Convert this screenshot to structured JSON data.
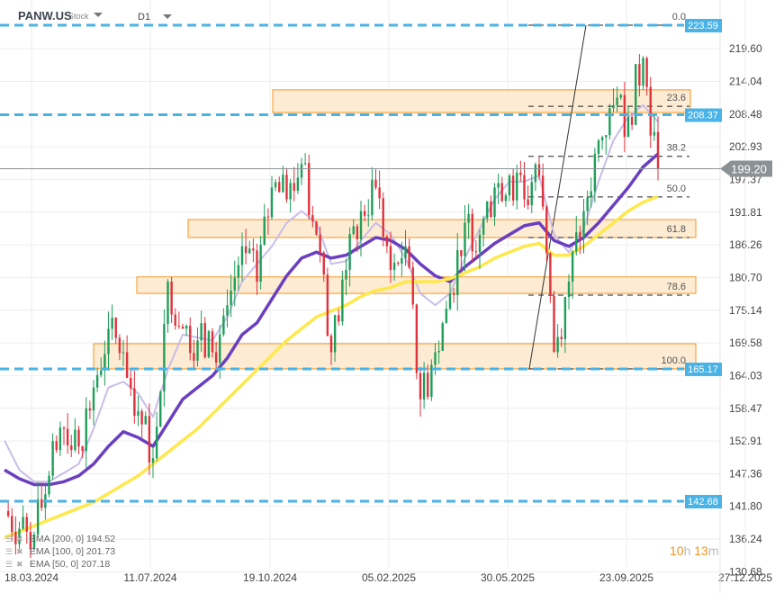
{
  "header": {
    "symbol": "PANW.US",
    "type": "Stock",
    "timeframe": "D1"
  },
  "legend": [
    {
      "label": "EMA [200,  0] 194.52",
      "color": "#ffe84d"
    },
    {
      "label": "EMA [100,  0] 201.73",
      "color": "#6a3fc0"
    },
    {
      "label": "EMA [50,  0] 207.18",
      "color": "#c9bde8"
    }
  ],
  "timer": {
    "hours": "10",
    "h": "h",
    "minutes": "13",
    "m": "m"
  },
  "chart_data": {
    "type": "candlestick",
    "ylim": [
      130.68,
      226.5
    ],
    "y_ticks": [
      "219.60",
      "214.04",
      "208.48",
      "202.93",
      "197.37",
      "191.81",
      "186.26",
      "180.70",
      "175.14",
      "169.58",
      "164.03",
      "158.47",
      "152.91",
      "147.36",
      "141.80",
      "136.24",
      "130.68"
    ],
    "x_ticks": [
      "18.03.2024",
      "11.07.2024",
      "19.10.2024",
      "05.02.2025",
      "30.05.2025",
      "23.09.2025",
      "27.12.2025"
    ],
    "dates": [
      "2024-02-09",
      "2024-02-23",
      "2024-03-08",
      "2024-03-22",
      "2024-04-05",
      "2024-04-19",
      "2024-05-03",
      "2024-05-17",
      "2024-05-31",
      "2024-06-14",
      "2024-06-28",
      "2024-07-12",
      "2024-07-26",
      "2024-08-09",
      "2024-08-23",
      "2024-09-06",
      "2024-09-20",
      "2024-10-04",
      "2024-10-18",
      "2024-11-01",
      "2024-11-15",
      "2024-11-29",
      "2024-12-13",
      "2024-12-27",
      "2025-01-10",
      "2025-01-24",
      "2025-02-07",
      "2025-02-21",
      "2025-03-07",
      "2025-03-21",
      "2025-04-04",
      "2025-04-18",
      "2025-05-02",
      "2025-05-16",
      "2025-05-30",
      "2025-06-13",
      "2025-06-27",
      "2025-07-11",
      "2025-07-25",
      "2025-08-08",
      "2025-08-22",
      "2025-09-05",
      "2025-09-19",
      "2025-10-03",
      "2025-10-17"
    ],
    "close": [
      141,
      138,
      137,
      147,
      155,
      152,
      162,
      172,
      168,
      158,
      150,
      180,
      172,
      170,
      168,
      176,
      186,
      180,
      196,
      194,
      200,
      188,
      168,
      182,
      192,
      196,
      182,
      186,
      160,
      168,
      178,
      190,
      188,
      196,
      198,
      194,
      198,
      168,
      180,
      192,
      204,
      210,
      208,
      218,
      199.2
    ],
    "series": [
      {
        "name": "EMA [200,  0]",
        "color": "#ffe84d",
        "values": [
          136.5,
          137.5,
          138.5,
          139.5,
          140.5,
          141.5,
          142.5,
          144,
          145.5,
          147,
          149,
          151,
          153,
          155,
          157.5,
          160,
          162.5,
          165,
          167.5,
          170,
          172,
          174,
          175,
          176,
          177.5,
          178.5,
          179,
          180,
          180,
          180,
          180.5,
          181.5,
          182.5,
          184,
          185,
          186,
          186.5,
          184.5,
          184.5,
          186,
          188,
          190,
          192,
          193.5,
          194.5
        ]
      },
      {
        "name": "EMA [100,  0]",
        "color": "#6a3fc0",
        "values": [
          148,
          146.5,
          145.5,
          145.5,
          146,
          147,
          149,
          152,
          154.5,
          153.5,
          152,
          156,
          160,
          162,
          164,
          167,
          171,
          173,
          177,
          181,
          184,
          185,
          184,
          184.5,
          186,
          187.5,
          187,
          185.5,
          183,
          181,
          180,
          182.5,
          184.5,
          186.5,
          188,
          189.5,
          190,
          187,
          186,
          187.5,
          190,
          193,
          196,
          199.5,
          201.7
        ]
      },
      {
        "name": "EMA [50,  0]",
        "color": "#c9bde8",
        "values": [
          153,
          148,
          146,
          146,
          147.5,
          149,
          155,
          162,
          163,
          161,
          157,
          165,
          171,
          170.5,
          170,
          174,
          180,
          183,
          186,
          190,
          192,
          190,
          183,
          183.5,
          187,
          190,
          188,
          184,
          178,
          176,
          178,
          184,
          189,
          194,
          197,
          197,
          198,
          188,
          185,
          189,
          197,
          204,
          208,
          210,
          207.2
        ]
      }
    ],
    "horizontal_levels": [
      {
        "value": 223.59,
        "label": "223.59"
      },
      {
        "value": 208.37,
        "label": "208.37"
      },
      {
        "value": 165.17,
        "label": "165.17"
      },
      {
        "value": 142.68,
        "label": "142.68"
      }
    ],
    "last_price": {
      "value": 199.2,
      "label": "199.20"
    },
    "zones": [
      {
        "from": 208.75,
        "to": 212.6
      },
      {
        "from": 187.5,
        "to": 190.55
      },
      {
        "from": 178.0,
        "to": 180.8
      },
      {
        "from": 165.17,
        "to": 169.45
      }
    ],
    "fibonacci": {
      "high": 223.59,
      "low": 165.17,
      "levels": [
        {
          "ratio": "0.0",
          "value": 223.59
        },
        {
          "ratio": "23.6",
          "value": 209.8
        },
        {
          "ratio": "38.2",
          "value": 201.3
        },
        {
          "ratio": "50.0",
          "value": 194.4
        },
        {
          "ratio": "61.8",
          "value": 187.5
        },
        {
          "ratio": "78.6",
          "value": 177.7
        },
        {
          "ratio": "100.0",
          "value": 165.17
        }
      ]
    },
    "colors": {
      "up": "#1e9e5a",
      "down": "#e0323c",
      "level": "#4ab3e6",
      "zone_fill": "#fdebd3",
      "zone_border": "#f7941d",
      "price_tag": "#8a9296"
    }
  }
}
